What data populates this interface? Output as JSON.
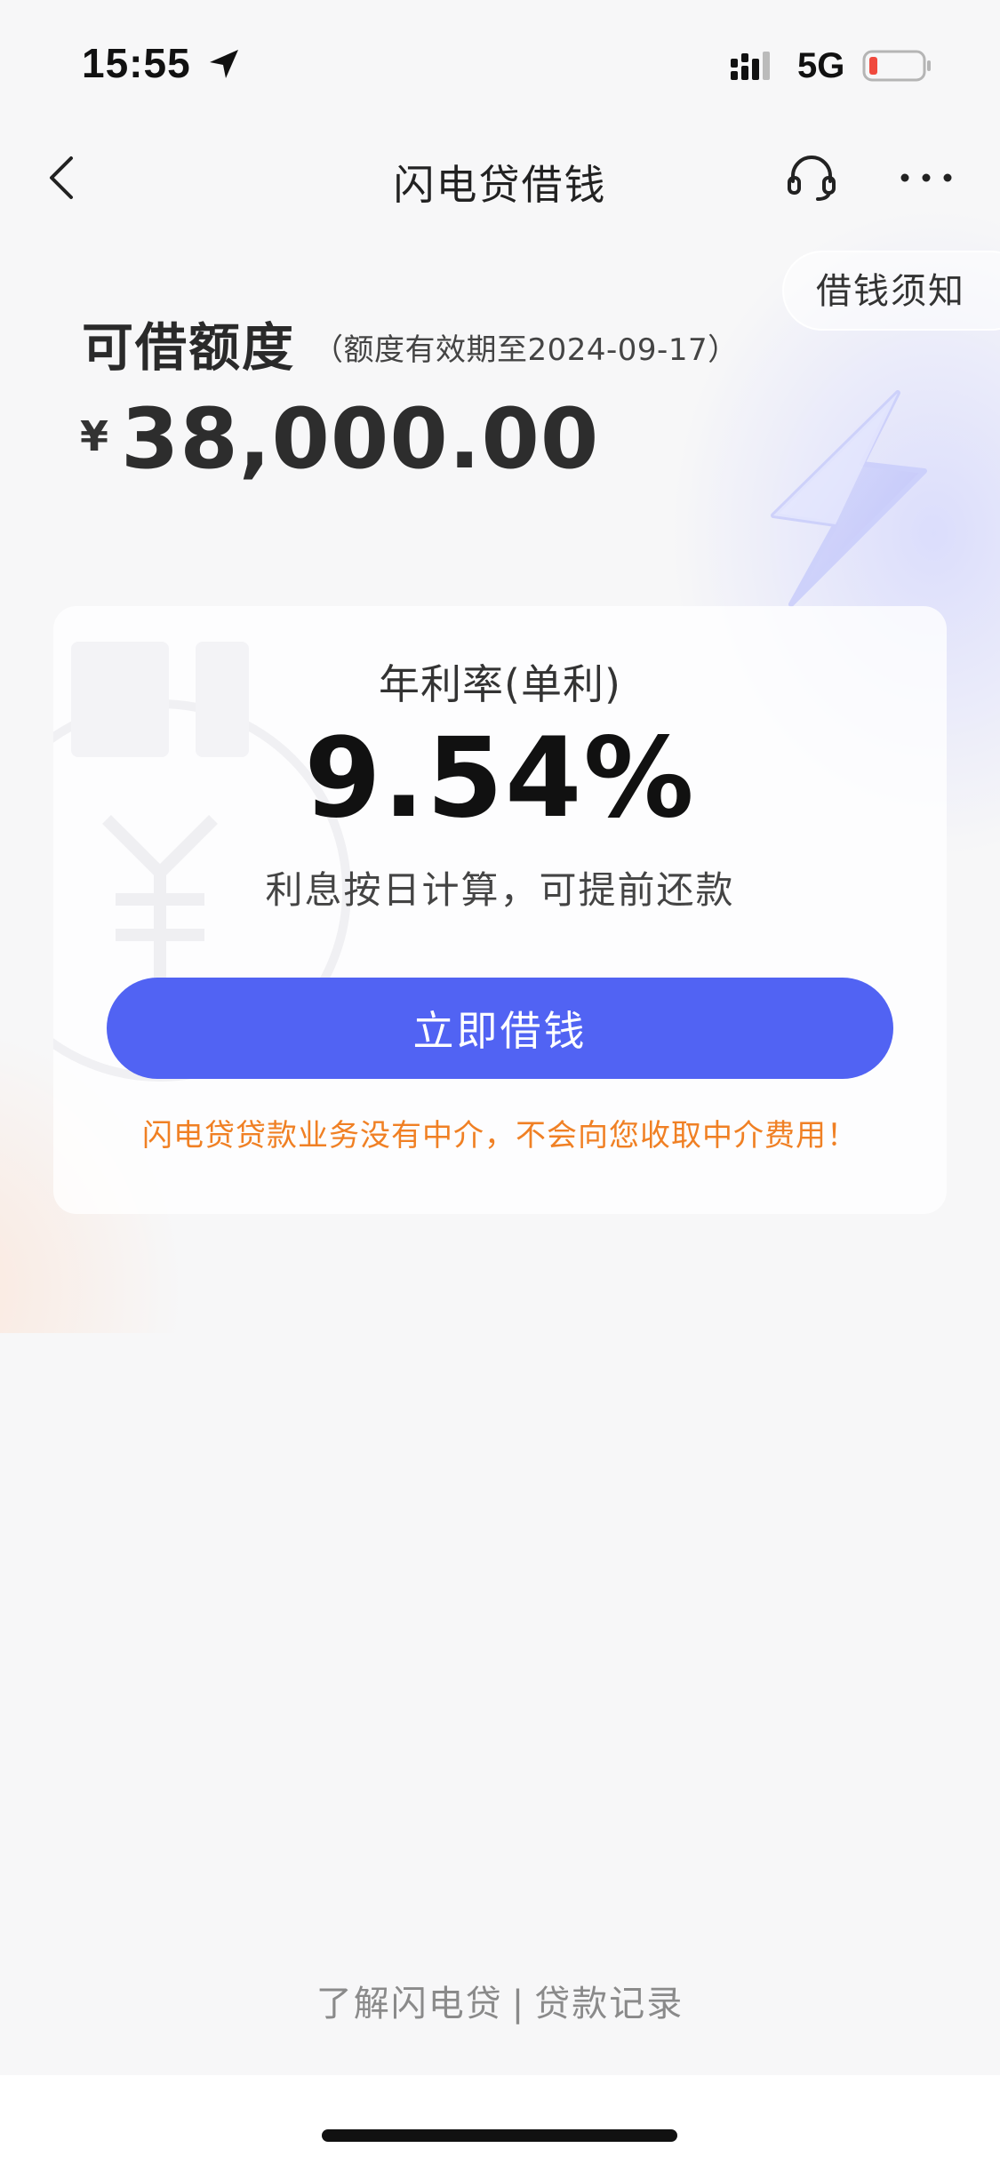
{
  "status_bar": {
    "time": "15:55",
    "network": "5G",
    "icons": [
      "location-arrow-icon",
      "signal-icon",
      "battery-low-icon"
    ],
    "battery_color": "#f04a3e"
  },
  "nav": {
    "title": "闪电贷借钱",
    "icons": [
      "back-chevron-icon",
      "headset-icon",
      "more-dots-icon"
    ]
  },
  "notice": {
    "label": "借钱须知"
  },
  "credit": {
    "title": "可借额度",
    "validity": "（额度有效期至2024-09-17）",
    "currency": "¥",
    "amount": "38,000.00"
  },
  "rate_card": {
    "label": "年利率(单利)",
    "value": "9.54%",
    "description": "利息按日计算，可提前还款",
    "button_label": "立即借钱",
    "warning": "闪电贷贷款业务没有中介，不会向您收取中介费用！",
    "accent_color": "#5163f3",
    "warning_color": "#f08024"
  },
  "footer": {
    "link_about": "了解闪电贷",
    "separator": "|",
    "link_records": "贷款记录"
  }
}
